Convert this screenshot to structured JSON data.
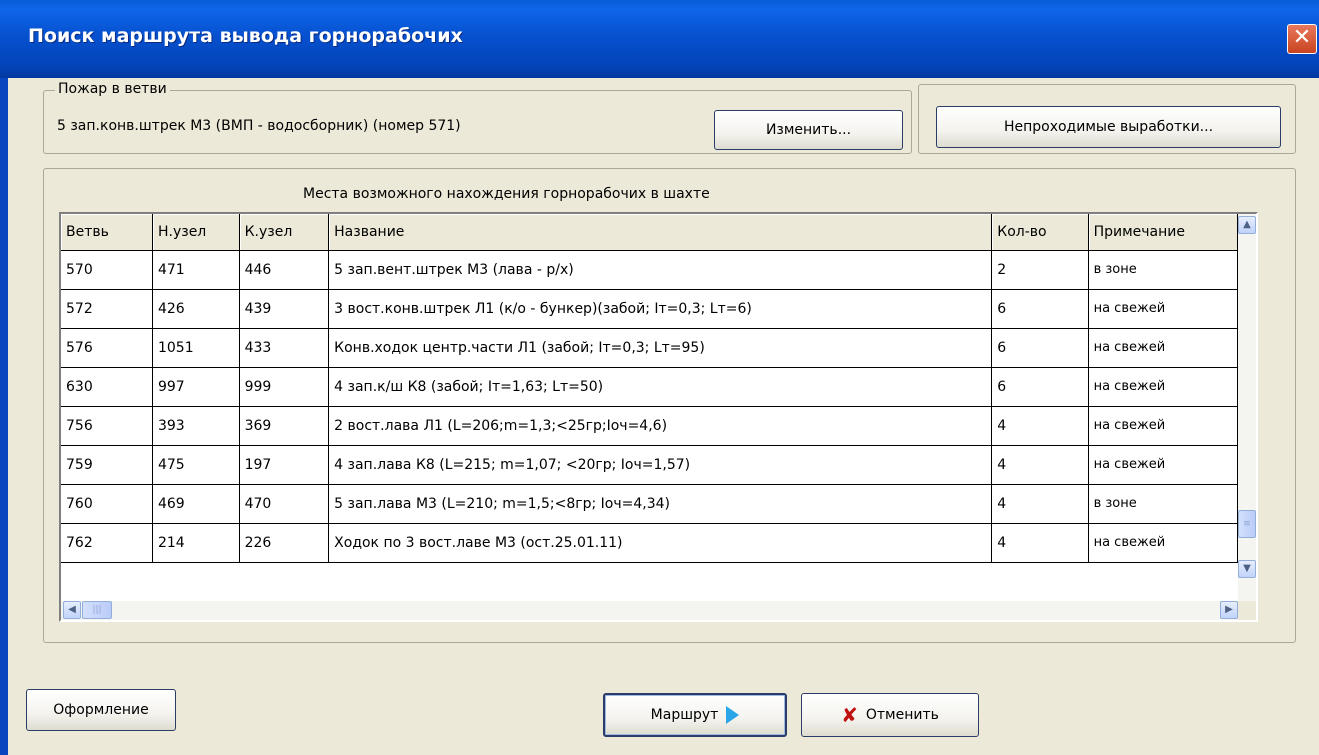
{
  "window": {
    "title": "Поиск маршрута вывода горнорабочих"
  },
  "fire": {
    "legend": "Пожар в ветви",
    "text": "5 зап.конв.штрек М3 (ВМП - водосборник)   (номер 571)",
    "change_label": "Изменить...",
    "impassable_label": "Непроходимые выработки..."
  },
  "table": {
    "caption": "Места возможного нахождения горнорабочих в шахте",
    "columns": [
      "Ветвь",
      "Н.узел",
      "К.узел",
      "Название",
      "Кол-во",
      "Примечание"
    ],
    "rows": [
      [
        "570",
        "471",
        "446",
        "5 зап.вент.штрек М3 (лава - р/х)",
        "2",
        "в зоне"
      ],
      [
        "572",
        "426",
        "439",
        "3 вост.конв.штрек Л1 (к/о - бункер)(забой; Iт=0,3; Lт=6)",
        "6",
        "на свежей"
      ],
      [
        "576",
        "1051",
        "433",
        "Конв.ходок центр.части Л1 (забой; Iт=0,3; Lт=95)",
        "6",
        "на свежей"
      ],
      [
        "630",
        "997",
        "999",
        "4 зап.к/ш К8 (забой; Iт=1,63; Lт=50)",
        "6",
        "на свежей"
      ],
      [
        "756",
        "393",
        "369",
        "2 вост.лава Л1 (L=206;m=1,3;<25гр;Iоч=4,6)",
        "4",
        "на свежей"
      ],
      [
        "759",
        "475",
        "197",
        "4 зап.лава К8 (L=215; m=1,07; <20гр; Iоч=1,57)",
        "4",
        "на свежей"
      ],
      [
        "760",
        "469",
        "470",
        "5 зап.лава М3 (L=210; m=1,5;<8гр; Iоч=4,34)",
        "4",
        "в зоне"
      ],
      [
        "762",
        "214",
        "226",
        "Ходок по 3 вост.лаве М3 (ост.25.01.11)",
        "4",
        "на свежей"
      ]
    ]
  },
  "buttons": {
    "design": "Оформление",
    "route": "Маршрут",
    "cancel": "Отменить"
  },
  "icons": {
    "close": "close-icon",
    "route": "play-arrow-icon",
    "cancel": "red-x-icon"
  }
}
